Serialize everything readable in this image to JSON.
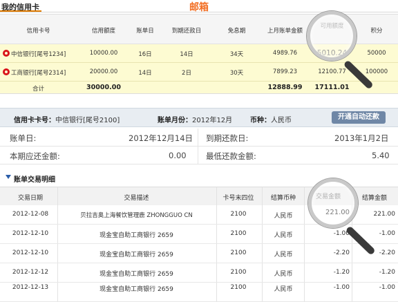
{
  "tab": {
    "label": "我的信用卡"
  },
  "header_badge": "邮箱",
  "summary": {
    "columns": [
      "信用卡号",
      "信用额度",
      "账单日",
      "到期还款日",
      "免息期",
      "上月账单金额",
      "可用额度",
      "积分"
    ],
    "rows": [
      {
        "card": "中信银行[尾号1234]",
        "limit": "10000.00",
        "bill_day": "16日",
        "due_day": "14日",
        "free_period": "34天",
        "last_bill": "4989.76",
        "available": "5010.24",
        "points": "50000"
      },
      {
        "card": "工商银行[尾号2314]",
        "limit": "20000.00",
        "bill_day": "14日",
        "due_day": "2日",
        "free_period": "30天",
        "last_bill": "7899.23",
        "available": "12100.77",
        "points": "100000"
      }
    ],
    "total": {
      "label": "合计",
      "limit": "30000.00",
      "last_bill": "12888.99",
      "available": "17111.01"
    }
  },
  "card_bar": {
    "card_label": "信用卡卡号：",
    "card_value": "中信银行[尾号2100]",
    "month_label": "账单月份：",
    "month_value": "2012年12月",
    "currency_label": "币种：",
    "currency_value": "人民币",
    "auto_repay_button": "开通自动还款"
  },
  "bill_info": {
    "bill_date_label": "账单日:",
    "bill_date_value": "2012年12月14日",
    "due_date_label": "到期还款日:",
    "due_date_value": "2013年1月2日",
    "due_amount_label": "本期应还金额:",
    "due_amount_value": "0.00",
    "min_payment_label": "最低还款金额:",
    "min_payment_value": "5.40"
  },
  "transactions": {
    "title": "账单交易明细",
    "columns": [
      "交易日期",
      "交易描述",
      "卡号末四位",
      "结算币种",
      "交易金额",
      "结算金额"
    ],
    "rows": [
      {
        "date": "2012-12-08",
        "desc": "贝拉吉奥上海餐饮管理鹿 ZHONGGUO CN",
        "card4": "2100",
        "currency": "人民币",
        "amount": "221.00",
        "settle": "221.00"
      },
      {
        "date": "2012-12-10",
        "desc": "现金宝自助工商银行 2659",
        "card4": "2100",
        "currency": "人民币",
        "amount": "-1.00",
        "settle": "-1.00"
      },
      {
        "date": "2012-12-10",
        "desc": "现金宝自助工商银行 2659",
        "card4": "2100",
        "currency": "人民币",
        "amount": "-2.20",
        "settle": "-2.20"
      },
      {
        "date": "2012-12-12",
        "desc": "现金宝自助工商银行 2659",
        "card4": "2100",
        "currency": "人民币",
        "amount": "-1.20",
        "settle": "-1.20"
      },
      {
        "date": "2012-12-13",
        "desc": "现金宝自助工商银行 2659",
        "card4": "2100",
        "currency": "人民币",
        "amount": "-1.00",
        "settle": "-1.00"
      }
    ]
  },
  "colors": {
    "accent_orange": "#f26d21",
    "highlight_row": "#fdfbd2",
    "button_blue": "#6f87a6"
  },
  "icons": [
    "citic-bank-logo-icon",
    "icbc-bank-logo-icon",
    "magnifier-icon",
    "triangle-down-icon"
  ]
}
